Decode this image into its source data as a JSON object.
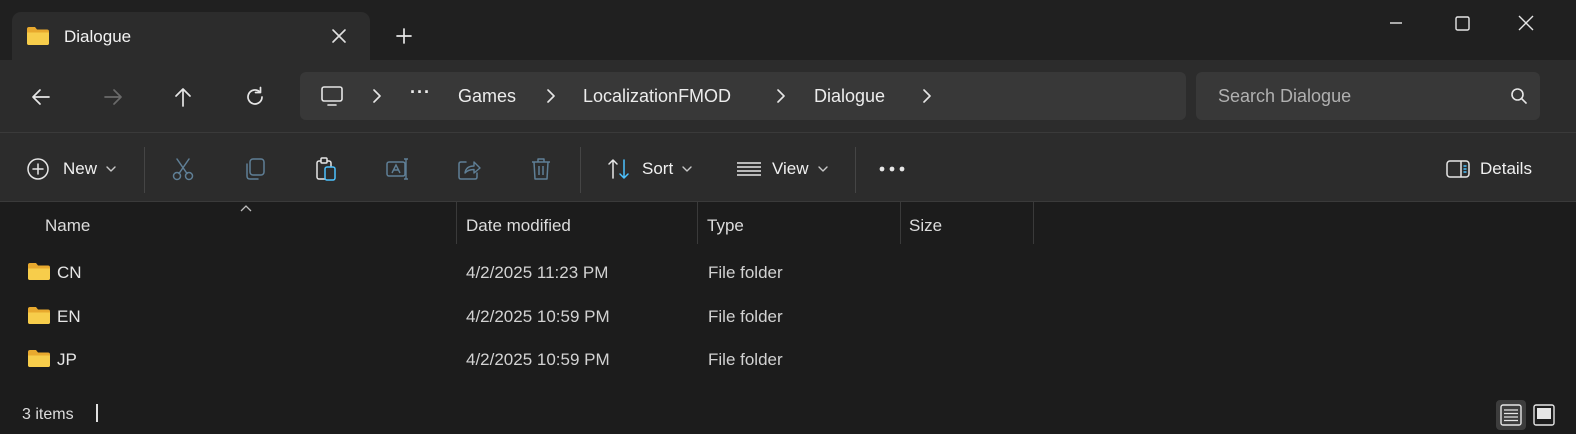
{
  "window": {
    "tab_title": "Dialogue",
    "tab_icon": "folder-icon"
  },
  "nav": {
    "breadcrumbs": [
      "Games",
      "LocalizationFMOD",
      "Dialogue"
    ],
    "overflow": "···",
    "search_placeholder": "Search Dialogue"
  },
  "commands": {
    "new_label": "New",
    "sort_label": "Sort",
    "view_label": "View",
    "details_label": "Details"
  },
  "columns": {
    "name": "Name",
    "date": "Date modified",
    "type": "Type",
    "size": "Size"
  },
  "files": [
    {
      "name": "CN",
      "date": "4/2/2025 11:23 PM",
      "type": "File folder",
      "size": ""
    },
    {
      "name": "EN",
      "date": "4/2/2025 10:59 PM",
      "type": "File folder",
      "size": ""
    },
    {
      "name": "JP",
      "date": "4/2/2025 10:59 PM",
      "type": "File folder",
      "size": ""
    }
  ],
  "status": {
    "item_count": "3 items"
  },
  "colors": {
    "folder": "#f5c441",
    "accent": "#4cc2ff"
  }
}
